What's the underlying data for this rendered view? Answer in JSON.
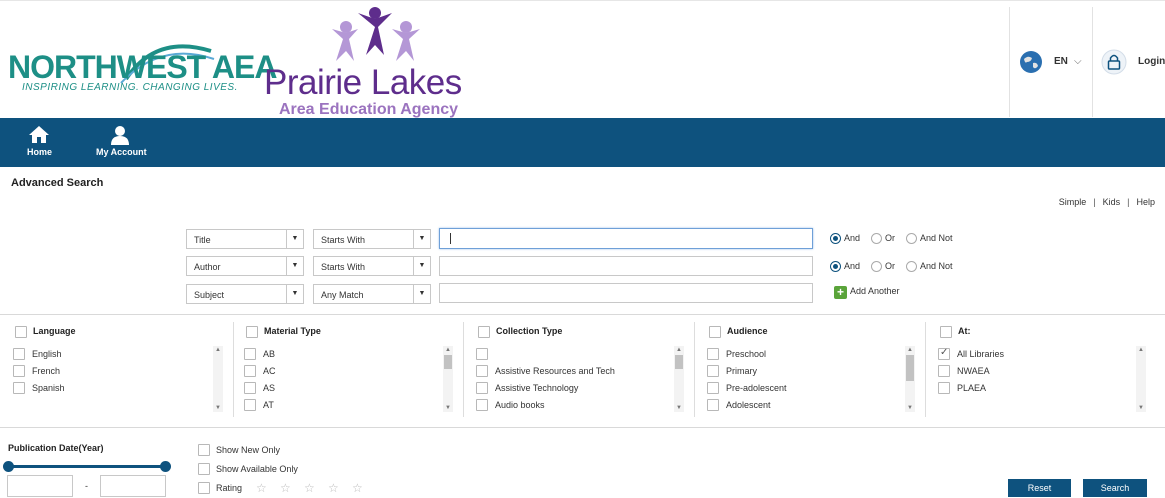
{
  "header": {
    "nw_logo_text": "NORTHWEST AEA",
    "nw_tagline": "INSPIRING LEARNING.  CHANGING LIVES.",
    "pl_logo_title": "Prairie Lakes",
    "pl_logo_sub": "Area Education Agency",
    "language": "EN",
    "login": "Login"
  },
  "nav": {
    "home": "Home",
    "account": "My Account"
  },
  "page": {
    "title": "Advanced Search",
    "links": [
      "Simple",
      "Kids",
      "Help"
    ]
  },
  "search_rows": [
    {
      "field": "Title",
      "operator": "Starts With",
      "value": "",
      "bool": "And"
    },
    {
      "field": "Author",
      "operator": "Starts With",
      "value": "",
      "bool": "And"
    },
    {
      "field": "Subject",
      "operator": "Any Match",
      "value": ""
    }
  ],
  "bool_labels": [
    "And",
    "Or",
    "And Not"
  ],
  "add_another": "Add Another",
  "facets": {
    "language": {
      "title": "Language",
      "items": [
        "English",
        "French",
        "Spanish"
      ]
    },
    "material": {
      "title": "Material Type",
      "items": [
        "AB",
        "AC",
        "AS",
        "AT"
      ]
    },
    "collection": {
      "title": "Collection Type",
      "items": [
        "",
        "Assistive Resources and Tech",
        "Assistive Technology",
        "Audio books"
      ]
    },
    "audience": {
      "title": "Audience",
      "items": [
        "Preschool",
        "Primary",
        "Pre-adolescent",
        "Adolescent"
      ]
    },
    "at": {
      "title": "At:",
      "items": [
        "All Libraries",
        "NWAEA",
        "PLAEA"
      ],
      "checked_index": 0
    }
  },
  "bottom": {
    "pub_date": "Publication Date(Year)",
    "date_sep": "-",
    "show_new": "Show New Only",
    "show_available": "Show Available Only",
    "rating": "Rating",
    "stars": 5,
    "reset": "Reset",
    "search": "Search"
  },
  "colors": {
    "navbar": "#0e527e",
    "nw_teal": "#1d8f86",
    "pl_purple": "#5e2d8c",
    "add_green": "#5aa43a"
  }
}
